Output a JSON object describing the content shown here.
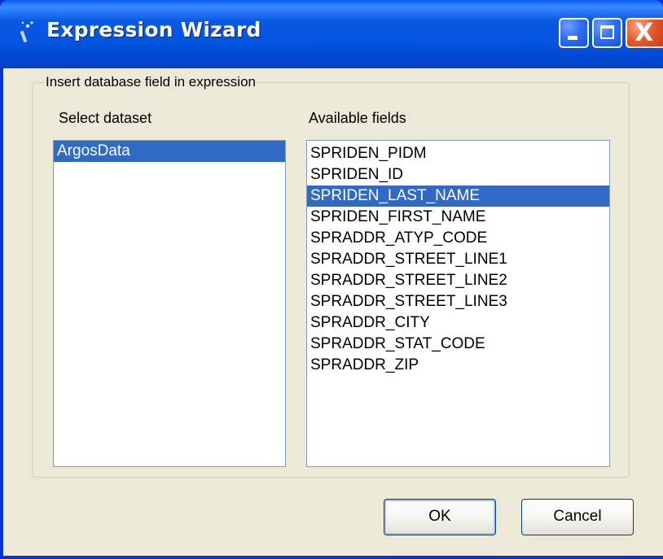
{
  "window": {
    "title": "Expression Wizard",
    "icon": "wand-icon",
    "controls": {
      "minimize": "minimize-icon",
      "maximize": "maximize-icon",
      "close": "close-icon",
      "close_glyph": "X"
    }
  },
  "group": {
    "label": "Insert database field in expression",
    "dataset_label": "Select dataset",
    "fields_label": "Available fields"
  },
  "datasets": [
    {
      "label": "ArgosData",
      "selected": true
    }
  ],
  "fields": [
    {
      "label": "SPRIDEN_PIDM",
      "selected": false
    },
    {
      "label": "SPRIDEN_ID",
      "selected": false
    },
    {
      "label": "SPRIDEN_LAST_NAME",
      "selected": true
    },
    {
      "label": "SPRIDEN_FIRST_NAME",
      "selected": false
    },
    {
      "label": "SPRADDR_ATYP_CODE",
      "selected": false
    },
    {
      "label": "SPRADDR_STREET_LINE1",
      "selected": false
    },
    {
      "label": "SPRADDR_STREET_LINE2",
      "selected": false
    },
    {
      "label": "SPRADDR_STREET_LINE3",
      "selected": false
    },
    {
      "label": "SPRADDR_CITY",
      "selected": false
    },
    {
      "label": "SPRADDR_STAT_CODE",
      "selected": false
    },
    {
      "label": "SPRADDR_ZIP",
      "selected": false
    }
  ],
  "buttons": {
    "ok": "OK",
    "cancel": "Cancel"
  },
  "colors": {
    "titlebar": "#0453dd",
    "selection": "#316ac5",
    "dialog_bg": "#ece9d8",
    "close_button": "#e55a2b"
  }
}
